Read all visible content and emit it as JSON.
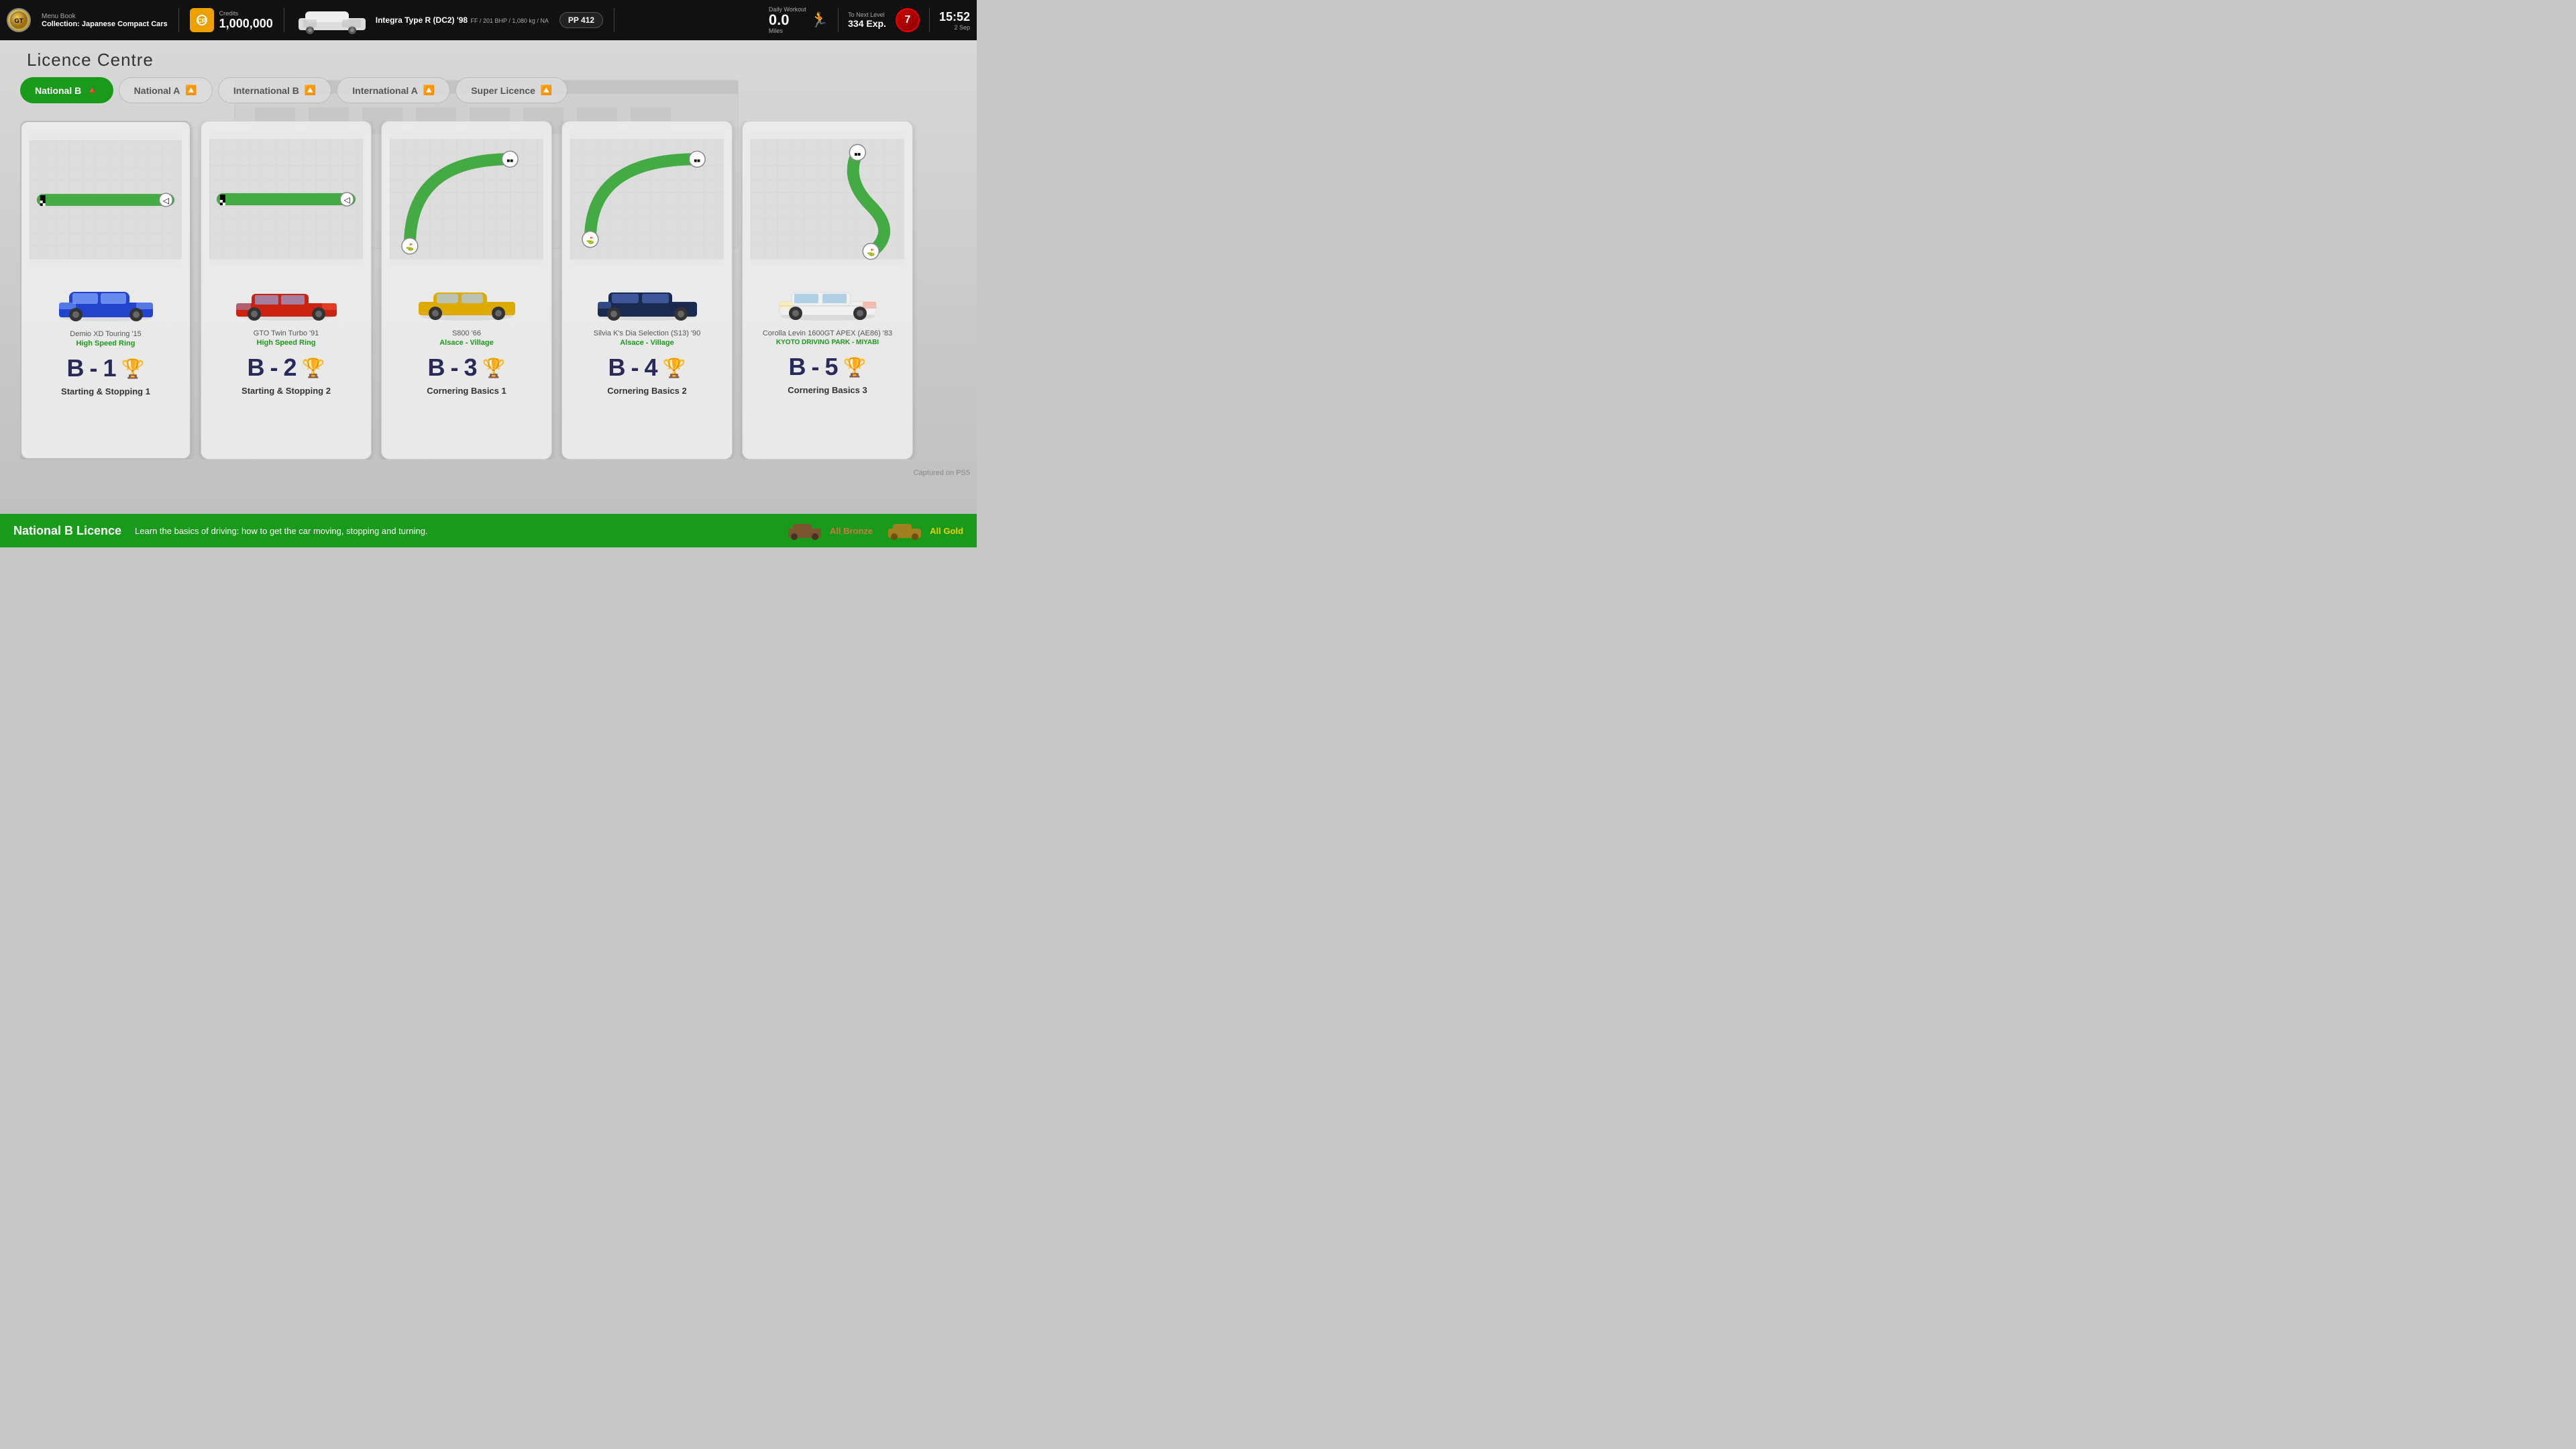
{
  "topbar": {
    "gt_logo": "GT",
    "menu_label": "Menu Book",
    "collection": "Collection: Japanese Compact Cars",
    "credits_label": "Credits",
    "credits_value": "1,000,000",
    "car_name": "Integra Type R (DC2) '98",
    "car_specs": "FF / 201 BHP / 1,080 kg / NA",
    "pp_value": "PP 412",
    "daily_label": "Daily Workout",
    "daily_miles": "0.0",
    "daily_unit": "Miles",
    "next_level_label": "To Next Level",
    "next_level_exp": "334 Exp.",
    "level_value": "7",
    "time": "15:52",
    "date": "2 Sep"
  },
  "page": {
    "title": "Licence Centre",
    "captured": "Captured on PS5"
  },
  "tabs": [
    {
      "id": "national-b",
      "label": "National B",
      "active": true,
      "cone": true
    },
    {
      "id": "national-a",
      "label": "National A",
      "active": false,
      "cone": true
    },
    {
      "id": "international-b",
      "label": "International B",
      "active": false,
      "cone": true
    },
    {
      "id": "international-a",
      "label": "International A",
      "active": false,
      "cone": true
    },
    {
      "id": "super-licence",
      "label": "Super Licence",
      "active": false,
      "cone": true
    }
  ],
  "cards": [
    {
      "id": "b1",
      "car": "Demio XD Touring '15",
      "track": "High Speed Ring",
      "badge": "B - 1",
      "trophy": "silver",
      "lesson": "Starting & Stopping 1",
      "track_type": "straight"
    },
    {
      "id": "b2",
      "car": "GTO Twin Turbo '91",
      "track": "High Speed Ring",
      "badge": "B - 2",
      "trophy": "gold",
      "lesson": "Starting & Stopping 2",
      "track_type": "straight"
    },
    {
      "id": "b3",
      "car": "S800 '66",
      "track": "Alsace - Village",
      "badge": "B - 3",
      "trophy": "gold",
      "lesson": "Cornering Basics 1",
      "track_type": "curve_right"
    },
    {
      "id": "b4",
      "car": "Silvia K's Dia Selection (S13) '90",
      "track": "Alsace - Village",
      "badge": "B - 4",
      "trophy": "none",
      "lesson": "Cornering Basics 2",
      "track_type": "curve_left"
    },
    {
      "id": "b5",
      "car": "Corolla Levin 1600GT APEX (AE86) '83",
      "track": "KYOTO DRIVING PARK - MIYABI",
      "badge": "B - 5",
      "trophy": "none",
      "lesson": "Cornering Basics 3",
      "track_type": "curve_slight"
    }
  ],
  "bottom_bar": {
    "title": "National B Licence",
    "description": "Learn the basics of driving: how to get the car moving, stopping and turning.",
    "all_bronze": "All Bronze",
    "all_gold": "All Gold"
  }
}
